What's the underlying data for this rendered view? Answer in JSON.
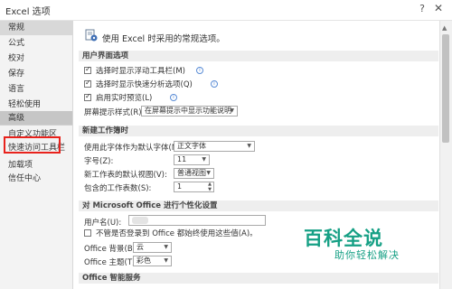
{
  "window": {
    "title": "Excel 选项",
    "help_icon": "?",
    "close_icon": "✕"
  },
  "sidebar": {
    "items": [
      {
        "label": "常规"
      },
      {
        "label": "公式"
      },
      {
        "label": "校对"
      },
      {
        "label": "保存"
      },
      {
        "label": "语言"
      },
      {
        "label": "轻松使用"
      },
      {
        "label": "高级"
      },
      {
        "label": "自定义功能区"
      },
      {
        "label": "快速访问工具栏"
      },
      {
        "label": "加载项"
      },
      {
        "label": "信任中心"
      }
    ]
  },
  "main": {
    "header": "使用 Excel 时采用的常规选项。",
    "sections": {
      "ui": "用户界面选项",
      "new_workbook": "新建工作簿时",
      "personalize": "对 Microsoft Office 进行个性化设置",
      "intelligent": "Office 智能服务"
    },
    "ui_options": {
      "mini_toolbar": "选择时显示浮动工具栏(M)",
      "quick_analysis": "选择时显示快速分析选项(Q)",
      "live_preview": "启用实时预览(L)",
      "screentip_label": "屏幕提示样式(R):",
      "screentip_value": "在屏幕提示中显示功能说明"
    },
    "new_workbook": {
      "font_label": "使用此字体作为默认字体(N):",
      "font_value": "正文字体",
      "size_label": "字号(Z):",
      "size_value": "11",
      "view_label": "新工作表的默认视图(V):",
      "view_value": "普通视图",
      "sheets_label": "包含的工作表数(S):",
      "sheets_value": "1"
    },
    "personalize": {
      "username_label": "用户名(U):",
      "always_use": "不管是否登录到 Office 都始终使用这些值(A)。",
      "bg_label": "Office 背景(B):",
      "bg_value": "云",
      "theme_label": "Office 主题(T):",
      "theme_value": "彩色"
    }
  },
  "watermark": {
    "title": "百科全说",
    "subtitle": "助你轻松解决"
  },
  "colors": {
    "highlight_box": "#e8221c",
    "watermark": "#16a085",
    "sidebar_bg": "#f3f3f3"
  }
}
